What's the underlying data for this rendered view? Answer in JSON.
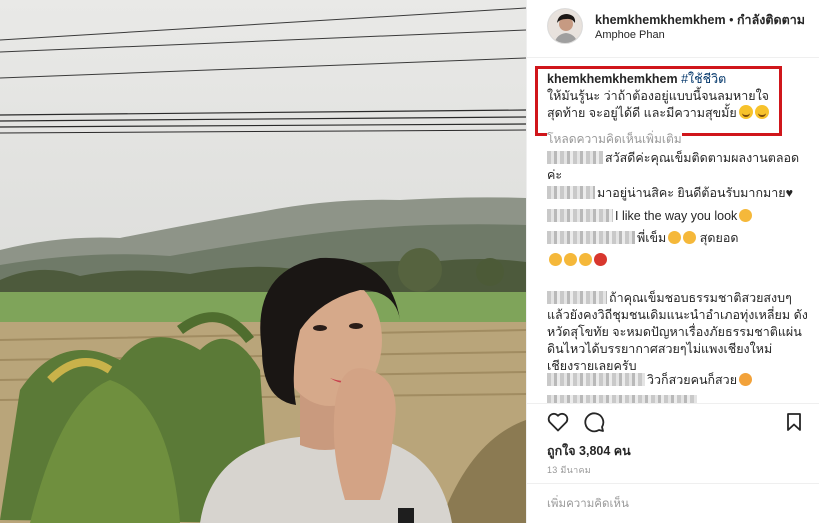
{
  "post": {
    "username": "khemkhemkhemkhem",
    "dot": "•",
    "follow_status": "กำลังติดตาม",
    "location": "Amphoe Phan"
  },
  "caption": {
    "username": "khemkhemkhemkhem",
    "hashtag": "#ใช้ชีวิต",
    "text": "ให้มันรู้นะ ว่าถ้าต้องอยู่แบบนี้จนลมหายใจสุดท้าย จะอยู่ได้ดี และมีความสุขมั้ย"
  },
  "load_more": "โหลดความคิดเห็นเพิ่มเติม",
  "comments": [
    {
      "text": "สวัสดีค่ะคุณเข็มติดตามผลงานตลอดค่ะ"
    },
    {
      "text": "มาอยู่น่านสิคะ ยินดีต้อนรับมากมาย"
    },
    {
      "text": "I like the way you look"
    },
    {
      "text": "พี่เข็ม",
      "text2": "สุดยอด"
    },
    {
      "text": "ถ้าคุณเข็มชอบธรรมชาติสวยสงบๆ แล้วยังคงวิถีชุมชนเดิมแนะนำอำเภอทุ่งเหลี่ยม ดังหวัดสุโขทัย จะหมดปัญหาเรื่องภัยธรรมชาติแผ่นดินไหวได้บรรยากาศสวยๆไม่แพงเชียงใหม่ เชียงรายเลยครับ"
    },
    {
      "text": "วิวก็สวยคนก็สวย"
    }
  ],
  "likes": "ถูกใจ 3,804 คน",
  "date": "13 มีนาคม",
  "add_comment_placeholder": "เพิ่มความคิดเห็น",
  "icons": {
    "like": "heart-icon",
    "comment": "comment-icon",
    "save": "bookmark-icon"
  }
}
